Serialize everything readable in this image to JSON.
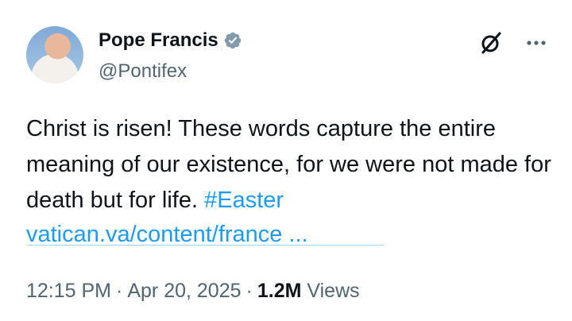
{
  "author": {
    "name": "Pope Francis",
    "handle": "@Pontifex",
    "verified": true,
    "badge_color": "#829aab"
  },
  "actions": {
    "grok_icon": "grok-slashed-circle-icon",
    "more_icon": "more-horizontal-icon"
  },
  "tweet": {
    "text": "Christ is risen! These words capture the entire meaning of our existence, for we were not made for death but for life. ",
    "hashtag": "#Easter",
    "link": "vatican.va/content/france",
    "link_ellipsis": "...",
    "link_color": "#1d9bf0"
  },
  "meta": {
    "time": "12:15 PM",
    "separator": "·",
    "date": "Apr 20, 2025",
    "views_count": "1.2M",
    "views_label": "Views"
  }
}
